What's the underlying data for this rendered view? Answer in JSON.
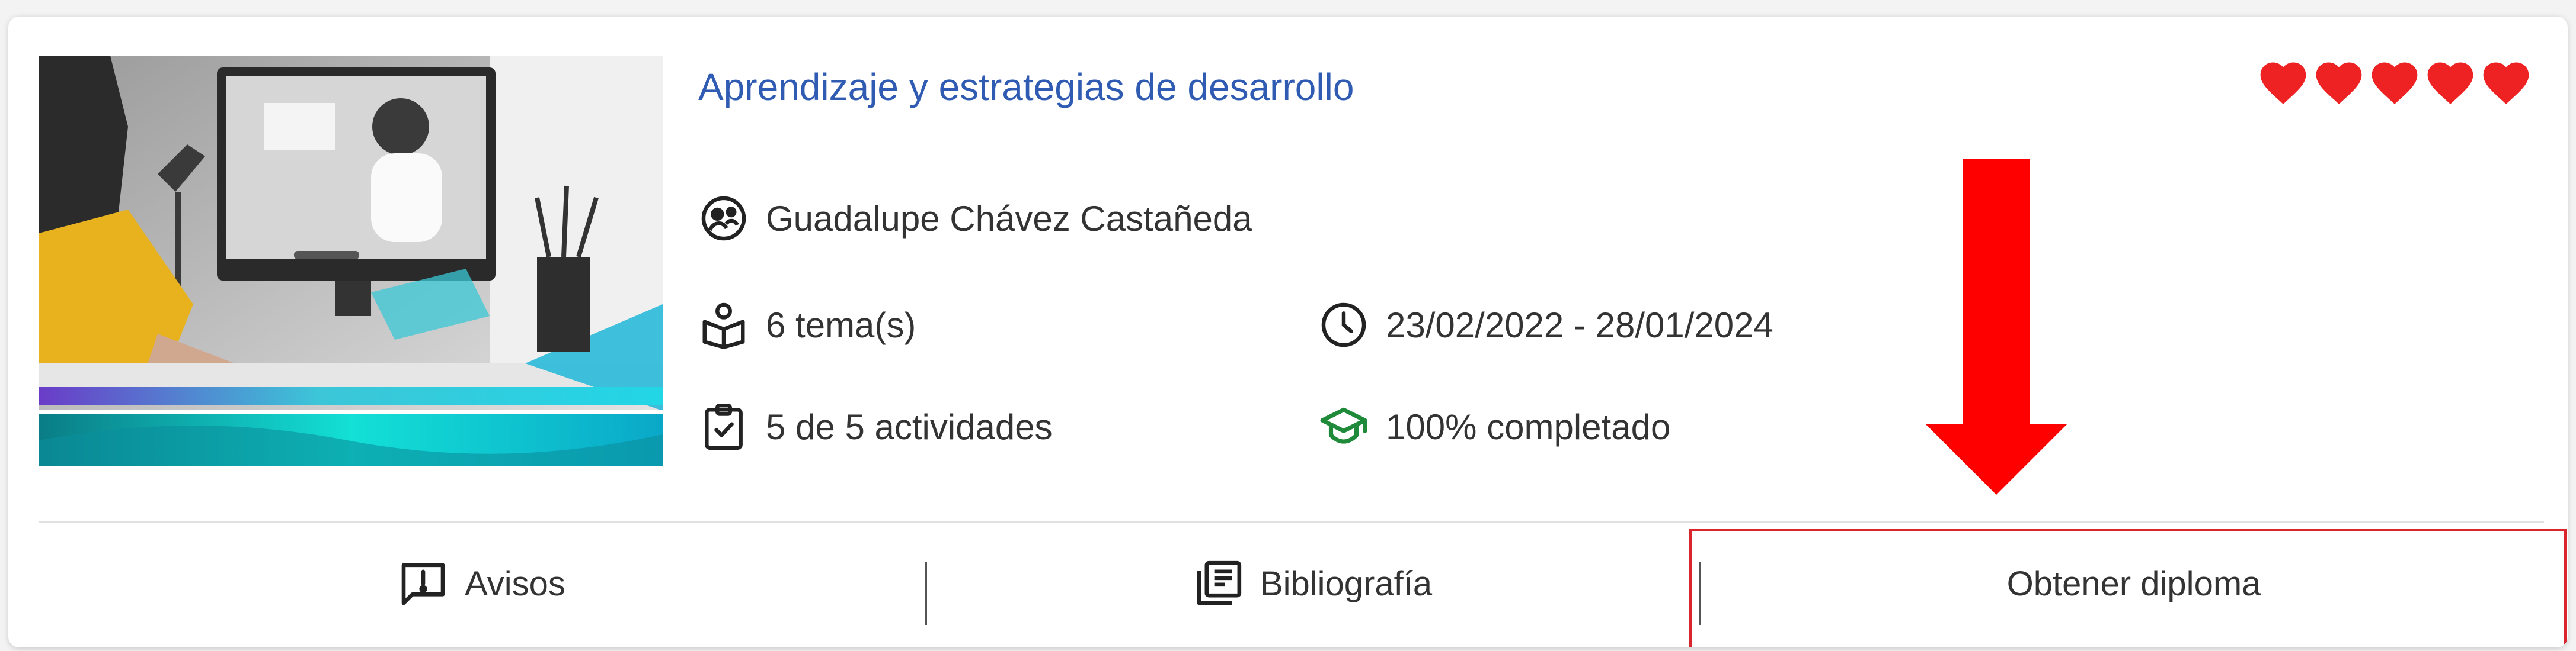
{
  "course": {
    "title": "Aprendizaje y estrategias de desarrollo",
    "teacher": "Guadalupe Chávez Castañeda",
    "topics": "6 tema(s)",
    "dates": "23/02/2022 - 28/01/2024",
    "activities": "5 de 5 actividades",
    "progress": "100% completado",
    "rating": 5,
    "rating_max": 5
  },
  "footer": {
    "avisos_label": "Avisos",
    "bibliografia_label": "Bibliografía",
    "diploma_label": "Obtener diploma"
  },
  "icons": {
    "teacher": "teacher-icon",
    "topics": "topics-icon",
    "dates": "clock-icon",
    "activities": "checklist-icon",
    "progress": "graduation-cap-icon",
    "avisos": "announcement-icon",
    "bibliografia": "library-books-icon",
    "rating": "heart-icon",
    "annotation": "red-down-arrow-icon"
  },
  "colors": {
    "title": "#2f5bb3",
    "heart": "#ee2222",
    "progress_icon": "#1f8a3a",
    "highlight": "#d9252e",
    "arrow": "#ff0000"
  }
}
